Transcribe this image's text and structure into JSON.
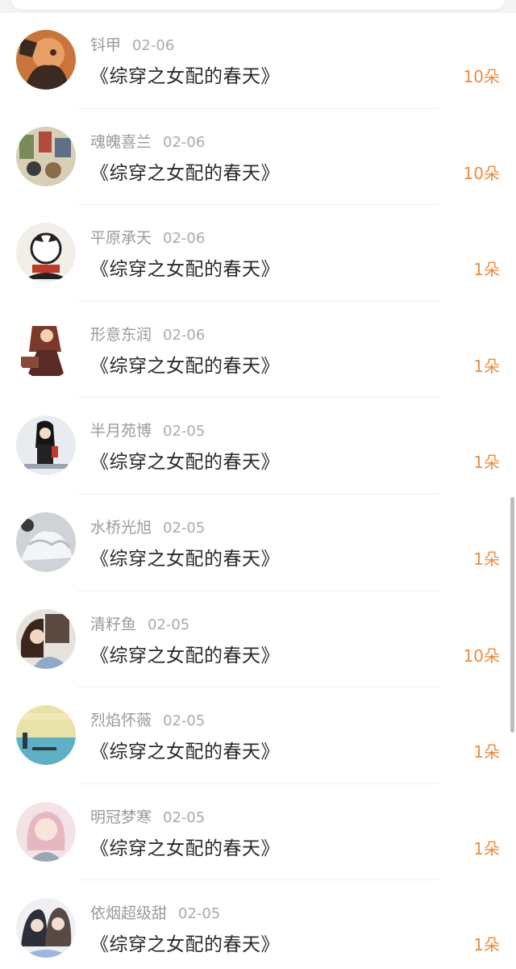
{
  "gift_list": {
    "book_title": "《综穿之女配的春天》",
    "rows": [
      {
        "user": "钭甲",
        "date": "02-06",
        "amount": "10朵",
        "avatar": "avatar-1"
      },
      {
        "user": "魂魄喜兰",
        "date": "02-06",
        "amount": "10朵",
        "avatar": "avatar-2"
      },
      {
        "user": "平原承天",
        "date": "02-06",
        "amount": "1朵",
        "avatar": "avatar-3"
      },
      {
        "user": "形意东润",
        "date": "02-06",
        "amount": "1朵",
        "avatar": "avatar-4"
      },
      {
        "user": "半月苑博",
        "date": "02-05",
        "amount": "1朵",
        "avatar": "avatar-5"
      },
      {
        "user": "水桥光旭",
        "date": "02-05",
        "amount": "1朵",
        "avatar": "avatar-6"
      },
      {
        "user": "清籽鱼",
        "date": "02-05",
        "amount": "10朵",
        "avatar": "avatar-7"
      },
      {
        "user": "烈焰怀薇",
        "date": "02-05",
        "amount": "1朵",
        "avatar": "avatar-8"
      },
      {
        "user": "明冠梦寒",
        "date": "02-05",
        "amount": "1朵",
        "avatar": "avatar-9"
      },
      {
        "user": "依烟超级甜",
        "date": "02-05",
        "amount": "1朵",
        "avatar": "avatar-10"
      }
    ]
  },
  "colors": {
    "amount": "#f08a3c",
    "username": "#9a9a9a",
    "title": "#2a2a2a",
    "divider": "#f0f0f0"
  }
}
